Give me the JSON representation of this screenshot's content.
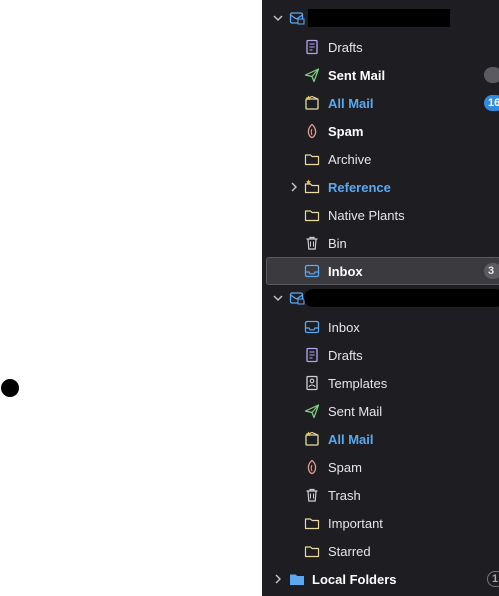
{
  "account1": {
    "folders": [
      {
        "label": "Drafts",
        "icon": "drafts-icon",
        "style": "normal"
      },
      {
        "label": "Sent Mail",
        "icon": "sent-icon",
        "style": "bold",
        "badge": ""
      },
      {
        "label": "All Mail",
        "icon": "all-mail-icon",
        "style": "blue",
        "badge": "16"
      },
      {
        "label": "Spam",
        "icon": "spam-icon",
        "style": "bold"
      },
      {
        "label": "Archive",
        "icon": "folder-icon",
        "style": "normal"
      },
      {
        "label": "Reference",
        "icon": "starred-folder-icon",
        "style": "blue"
      },
      {
        "label": "Native Plants",
        "icon": "folder-icon",
        "style": "normal"
      },
      {
        "label": "Bin",
        "icon": "trash-icon",
        "style": "normal"
      },
      {
        "label": "Inbox",
        "icon": "inbox-icon",
        "style": "bold",
        "badge": "3"
      }
    ]
  },
  "account2": {
    "folders": [
      {
        "label": "Inbox",
        "icon": "inbox-icon",
        "style": "normal"
      },
      {
        "label": "Drafts",
        "icon": "drafts-icon",
        "style": "normal"
      },
      {
        "label": "Templates",
        "icon": "templates-icon",
        "style": "normal"
      },
      {
        "label": "Sent Mail",
        "icon": "sent-icon",
        "style": "normal"
      },
      {
        "label": "All Mail",
        "icon": "all-mail-icon",
        "style": "blue"
      },
      {
        "label": "Spam",
        "icon": "spam-icon",
        "style": "normal"
      },
      {
        "label": "Trash",
        "icon": "trash-icon",
        "style": "normal"
      },
      {
        "label": "Important",
        "icon": "folder-icon",
        "style": "normal"
      },
      {
        "label": "Starred",
        "icon": "folder-icon",
        "style": "normal"
      }
    ]
  },
  "local_folders": {
    "label": "Local Folders",
    "badge": "1"
  },
  "colors": {
    "pane_bg": "#1e1e22",
    "accent_blue": "#5aa8f0",
    "badge_blue": "#2f8be0",
    "sent_green": "#7fd67f",
    "drafts_purple": "#b7a4f0",
    "spam_red": "#e89a8a",
    "folder_yellow": "#e8d9a0"
  }
}
